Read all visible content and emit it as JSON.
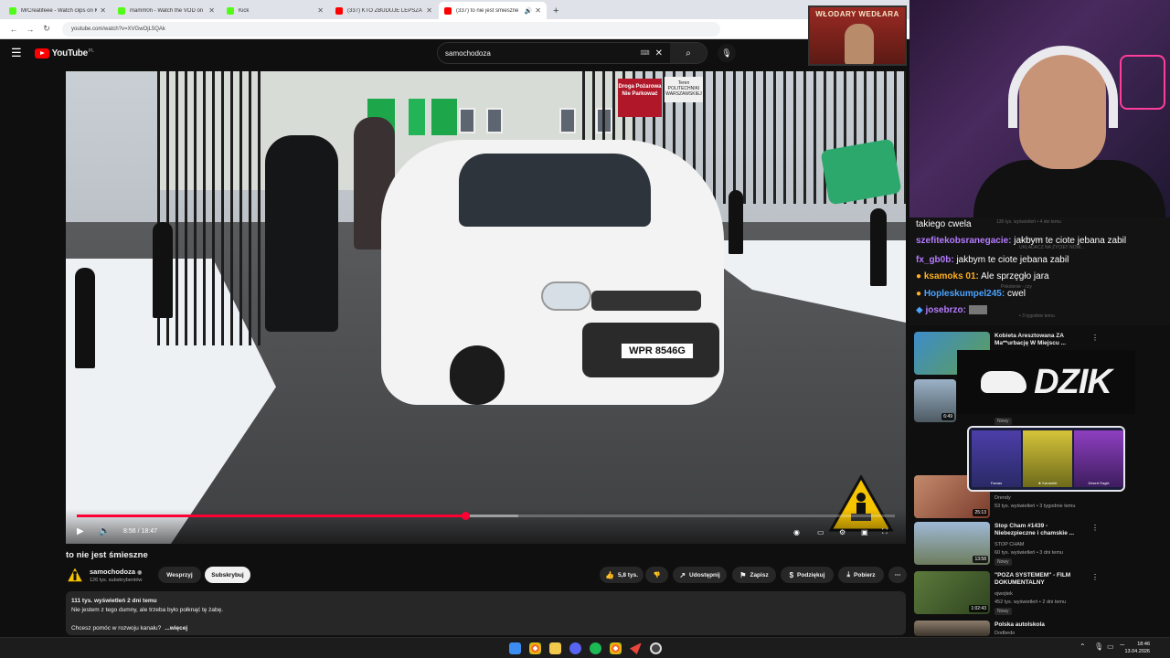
{
  "browser": {
    "tabs": [
      {
        "title": "MrCreatifeee - Watch clips on K",
        "favicon_color": "#53fc18",
        "active": false
      },
      {
        "title": "mamm0n - Watch the VOD on",
        "favicon_color": "#53fc18",
        "active": false
      },
      {
        "title": "Kick",
        "favicon_color": "#53fc18",
        "active": false
      },
      {
        "title": "(337) KTO ZBUDUJE LEPSZA RZ",
        "favicon_color": "#ff0000",
        "active": false
      },
      {
        "title": "(337) to nie jest śmieszne",
        "favicon_color": "#ff0000",
        "active": true
      }
    ],
    "url": "youtube.com/watch?v=XVGwOjL5QAk"
  },
  "youtube": {
    "logo_text": "YouTube",
    "region": "PL",
    "search_value": "samochodoza"
  },
  "player": {
    "time_current": "8:56",
    "time_total": "18:47",
    "progress_fraction": 0.475,
    "buffered_fraction": 0.54,
    "plate_text": "WPR 8546G",
    "sign_red_text": "Droga Pożarowa Nie Parkować",
    "sign_white_text": "Teren POLITECHNIKI WARSZAWSKIEJ"
  },
  "video": {
    "title": "to nie jest śmieszne",
    "channel": "samochodoza",
    "subscribers": "126 tys. subskrybentów",
    "support_label": "Wesprzyj",
    "subscribe_label": "Subskrybuj",
    "likes": "5,8 tys.",
    "share_label": "Udostępnij",
    "save_label": "Zapisz",
    "thanks_label": "Podziękuj",
    "download_label": "Pobierz",
    "views_date": "111 tys. wyświetleń  2 dni temu",
    "description_line1": "Nie jestem z tego dumny, ale trzeba było połknąć tę żabę.",
    "description_line2": "Chcesz pomóc w rozwoju kanału?",
    "more_label": "...więcej"
  },
  "overlay": {
    "banner_text": "WŁODARY WEDŁARA",
    "dzik_text": "DZIK",
    "case_items": [
      {
        "label": "Famas"
      },
      {
        "label": "★ Karambit"
      },
      {
        "label": "Desert Eagle"
      }
    ]
  },
  "chat": [
    {
      "user": "",
      "message": "takiego cwela",
      "user_color": "#ffffff"
    },
    {
      "user": "szefitekobsranegacie:",
      "message": "jakbym te ciote jebana zabil",
      "user_color": "#b57bff"
    },
    {
      "user": "fx_gb0b:",
      "message": "jakbym te ciote jebana zabil",
      "user_color": "#b57bff"
    },
    {
      "user": "ksamoks 01:",
      "message": "Ale sprzęgło jara",
      "user_color": "#ffb020"
    },
    {
      "user": "Hopleskumpel245:",
      "message": "cwel",
      "user_color": "#4aa3ff"
    },
    {
      "user": "josebrzo:",
      "message": "",
      "user_color": "#b57bff"
    }
  ],
  "recommendations": [
    {
      "title": "Kobieta Aresztowana ZA Ma**urbację W Miejscu ...",
      "channel": "",
      "meta": "",
      "duration": "",
      "new": false
    },
    {
      "title": "",
      "channel": "",
      "meta": "",
      "duration": "6:49",
      "new": true
    },
    {
      "title": "",
      "channel": "Drendy",
      "meta": "53 tys. wyświetleń • 3 tygodnie temu",
      "duration": "25:13",
      "new": false
    },
    {
      "title": "Stop Cham #1439 - Niebezpieczne i chamskie ...",
      "channel": "STOP CHAM",
      "meta": "60 tys. wyświetleń • 3 dni temu",
      "duration": "13:58",
      "new": true
    },
    {
      "title": "\"POZA SYSTEMEM\" - FILM DOKUMENTALNY",
      "channel": "ojwojtek",
      "meta": "452 tys. wyświetleń • 2 dni temu",
      "duration": "1:02:43",
      "new": true
    },
    {
      "title": "Polska autolskola",
      "channel": "Dodbedo",
      "meta": "",
      "duration": "",
      "new": false
    }
  ],
  "taskbar": {
    "time": "18:46",
    "date": "13.04.2026"
  }
}
